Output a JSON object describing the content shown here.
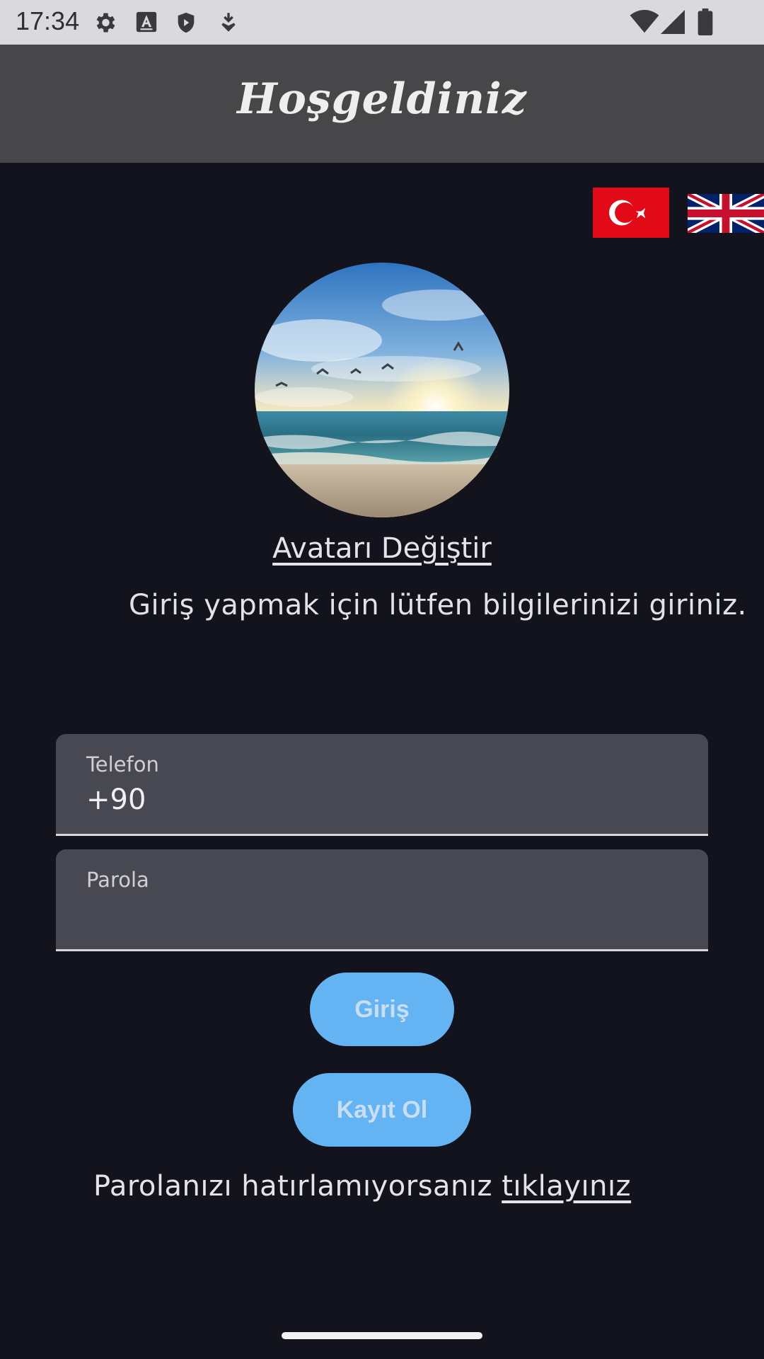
{
  "status_bar": {
    "time": "17:34",
    "icons_left": [
      "settings-icon",
      "font-icon",
      "shield-icon",
      "download-icon"
    ],
    "icons_right": [
      "wifi-icon",
      "signal-icon",
      "battery-icon"
    ]
  },
  "app_bar": {
    "title": "Hoşgeldiniz"
  },
  "language": {
    "options": [
      {
        "name": "turkish-flag-icon",
        "color": "#e30a17"
      },
      {
        "name": "uk-flag-icon",
        "color": "#012169"
      }
    ]
  },
  "avatar": {
    "change_label": "Avatarı Değiştir"
  },
  "subtitle": "Giriş yapmak için lütfen bilgilerinizi giriniz.",
  "form": {
    "phone": {
      "label": "Telefon",
      "value": "+90"
    },
    "password": {
      "label": "Parola",
      "value": ""
    }
  },
  "buttons": {
    "login": "Giriş",
    "register": "Kayıt Ol"
  },
  "forgot": {
    "text": "Parolanızı hatırlamıyorsanız",
    "link": "tıklayınız"
  },
  "colors": {
    "background": "#12131c",
    "app_bar": "#474749",
    "field": "#474852",
    "button": "#64b4f4"
  }
}
